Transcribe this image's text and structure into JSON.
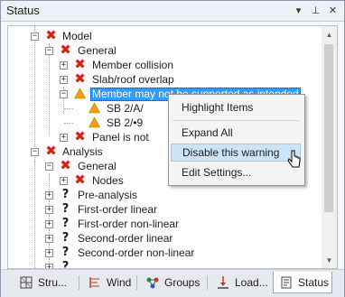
{
  "panel": {
    "title": "Status",
    "buttons": {
      "dropdown": "▾",
      "pin": "⊥",
      "close": "✕"
    }
  },
  "tree": {
    "rows": [
      {
        "label": "Model",
        "status": "error",
        "expander": "−"
      },
      {
        "label": "General",
        "status": "error",
        "expander": "−"
      },
      {
        "label": "Member collision",
        "status": "error",
        "expander": "+"
      },
      {
        "label": "Slab/roof overlap",
        "status": "error",
        "expander": "+"
      },
      {
        "label": "Member may not be supported as intended",
        "status": "warning",
        "expander": "−",
        "selected": true
      },
      {
        "label": "SB 2/A/",
        "status": "warning"
      },
      {
        "label": "SB 2/•9",
        "status": "warning"
      },
      {
        "label": "Panel is not",
        "status": "error",
        "expander": "+"
      },
      {
        "label": "Analysis",
        "status": "error",
        "expander": "−"
      },
      {
        "label": "General",
        "status": "error",
        "expander": "−"
      },
      {
        "label": "Nodes",
        "status": "error",
        "expander": "+"
      },
      {
        "label": "Pre-analysis",
        "status": "unknown",
        "expander": "+"
      },
      {
        "label": "First-order linear",
        "status": "unknown",
        "expander": "+"
      },
      {
        "label": "First-order non-linear",
        "status": "unknown",
        "expander": "+"
      },
      {
        "label": "Second-order linear",
        "status": "unknown",
        "expander": "+"
      },
      {
        "label": "Second-order non-linear",
        "status": "unknown",
        "expander": "+"
      }
    ]
  },
  "context_menu": {
    "items": [
      "Highlight Items",
      "Expand All",
      "Disable this warning",
      "Edit Settings..."
    ],
    "hovered": "Disable this warning"
  },
  "tabs": [
    {
      "label": "Stru...",
      "icon": "structure-icon"
    },
    {
      "label": "Wind",
      "icon": "wind-icon"
    },
    {
      "label": "Groups",
      "icon": "groups-icon"
    },
    {
      "label": "Load...",
      "icon": "load-icon"
    },
    {
      "label": "Status",
      "icon": "status-icon",
      "active": true
    }
  ],
  "colors": {
    "error": "#d32222",
    "warning": "#f0a30a",
    "selection": "#3399ff",
    "menu_hover": "#cce4f7"
  }
}
